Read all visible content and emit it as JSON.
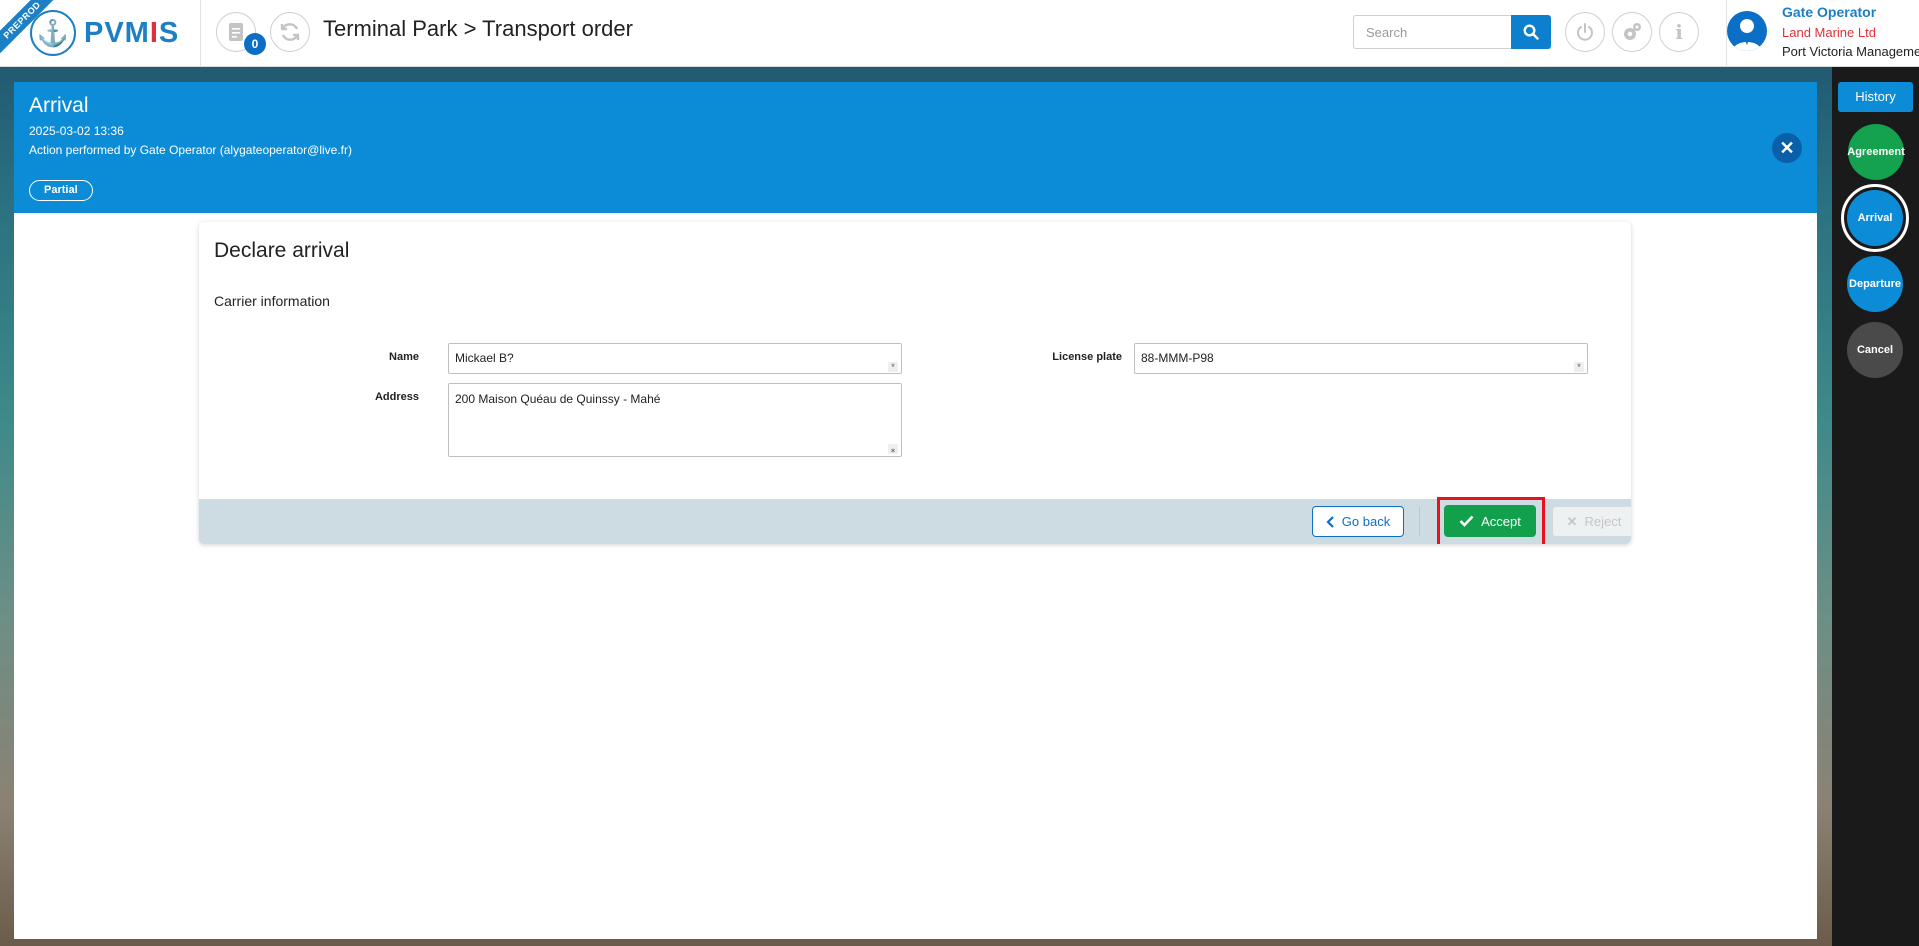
{
  "header": {
    "ribbon": "PREPROD",
    "logo_text_left": "PVM",
    "logo_text_accent": "I",
    "logo_text_right": "S",
    "notification_count": "0",
    "title": "Terminal Park > Transport order",
    "search_placeholder": "Search",
    "user": {
      "role": "Gate Operator",
      "company": "Land Marine Ltd",
      "organization": "Port Victoria Management"
    }
  },
  "banner": {
    "title": "Arrival",
    "date": "2025-03-02 13:36",
    "action": "Action performed by Gate Operator (alygateoperator@live.fr)",
    "badge": "Partial",
    "close": "✕"
  },
  "form": {
    "title": "Declare arrival",
    "section": "Carrier information",
    "name_label": "Name",
    "name_value": "Mickael B?",
    "address_label": "Address",
    "address_value": "200 Maison Quéau de Quinssy - Mahé",
    "plate_label": "License plate",
    "plate_value": "88-MMM-P98"
  },
  "actions": {
    "go_back": "Go back",
    "accept": "Accept",
    "reject": "Reject"
  },
  "sidebar": {
    "history": "History",
    "steps": [
      {
        "label": "Agreement",
        "color": "#14a24e"
      },
      {
        "label": "Arrival",
        "color": "#0c8cd6"
      },
      {
        "label": "Departure",
        "color": "#0c8cd6"
      },
      {
        "label": "Cancel",
        "color": "#4a4a4a"
      }
    ]
  }
}
